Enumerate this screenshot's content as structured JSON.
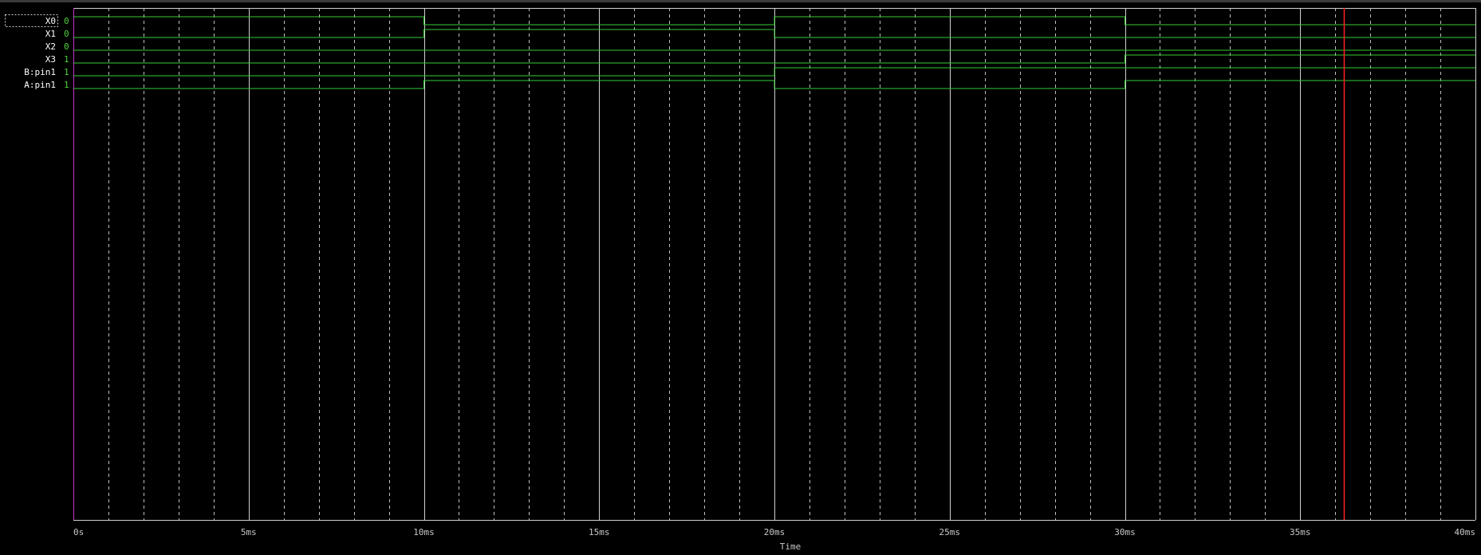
{
  "colors": {
    "background": "#000000",
    "grid_major": "#d0d0d0",
    "grid_minor": "#bdbdbd",
    "trace": "#33cc33",
    "cursor": "#ff2020",
    "origin_axis": "#cc33cc",
    "label_text": "#ffffff",
    "value_text": "#4cd137",
    "tick_text": "#c8c8c8"
  },
  "chart_data": {
    "type": "line",
    "subtype": "digital-timing-diagram",
    "xlabel": "Time",
    "ylabel": "",
    "title": "",
    "xlim": [
      0,
      40
    ],
    "x_unit": "ms",
    "x_tick_labels": [
      "0s",
      "5ms",
      "10ms",
      "15ms",
      "20ms",
      "25ms",
      "30ms",
      "35ms",
      "40ms"
    ],
    "x_ticks": [
      0,
      5,
      10,
      15,
      20,
      25,
      30,
      35,
      40
    ],
    "minor_grid_step": 1,
    "grid": true,
    "cursor_time": 36.25,
    "series": [
      {
        "name": "X0",
        "value": "0",
        "selected": true,
        "segments": [
          [
            0,
            10,
            1
          ],
          [
            10,
            20,
            0
          ],
          [
            20,
            30,
            1
          ],
          [
            30,
            40,
            0
          ]
        ]
      },
      {
        "name": "X1",
        "value": "0",
        "selected": false,
        "segments": [
          [
            0,
            10,
            0
          ],
          [
            10,
            20,
            1
          ],
          [
            20,
            30,
            0
          ],
          [
            30,
            40,
            0
          ]
        ]
      },
      {
        "name": "X2",
        "value": "0",
        "selected": false,
        "segments": [
          [
            0,
            10,
            0
          ],
          [
            10,
            20,
            0
          ],
          [
            20,
            30,
            0
          ],
          [
            30,
            40,
            0
          ]
        ]
      },
      {
        "name": "X3",
        "value": "1",
        "selected": false,
        "segments": [
          [
            0,
            10,
            0
          ],
          [
            10,
            20,
            0
          ],
          [
            20,
            30,
            0
          ],
          [
            30,
            40,
            1
          ]
        ]
      },
      {
        "name": "B:pin1",
        "value": "1",
        "selected": false,
        "segments": [
          [
            0,
            10,
            0
          ],
          [
            10,
            20,
            0
          ],
          [
            20,
            30,
            1
          ],
          [
            30,
            40,
            1
          ]
        ]
      },
      {
        "name": "A:pin1",
        "value": "1",
        "selected": false,
        "segments": [
          [
            0,
            10,
            0
          ],
          [
            10,
            20,
            1
          ],
          [
            20,
            30,
            0
          ],
          [
            30,
            40,
            1
          ]
        ]
      }
    ]
  }
}
